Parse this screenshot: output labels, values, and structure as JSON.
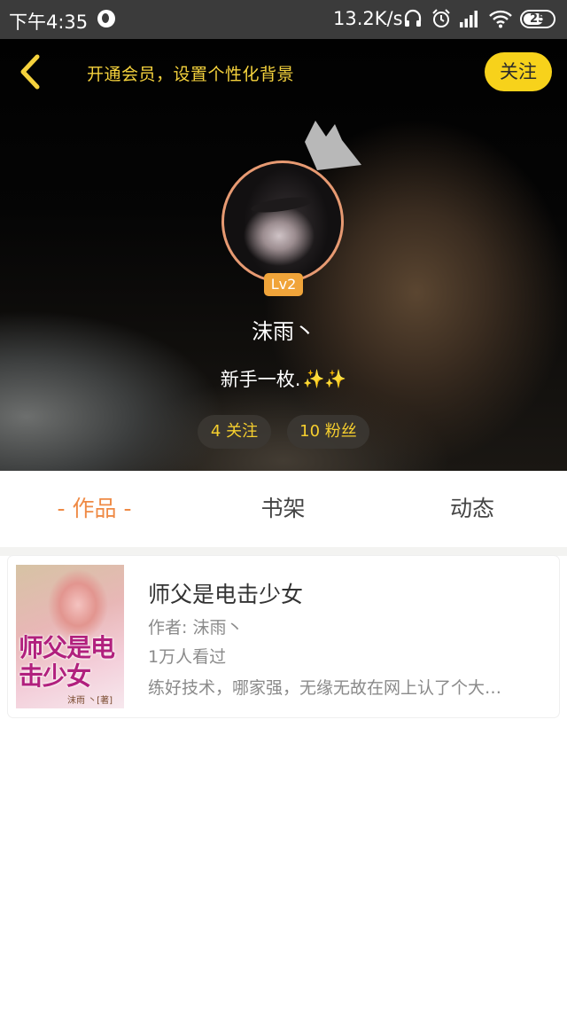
{
  "status_bar": {
    "time": "下午4:35",
    "network_speed": "13.2K/s",
    "battery_level": "25",
    "icons": [
      "globe-icon",
      "headphones-icon",
      "alarm-icon",
      "signal-icon",
      "wifi-icon",
      "battery-icon"
    ]
  },
  "header": {
    "member_banner": "开通会员，设置个性化背景",
    "follow_label": "关注",
    "level": "Lv2",
    "username": "沫雨丶",
    "bio": "新手一枚.",
    "bio_emoji": "✨✨",
    "following": "4 关注",
    "followers": "10 粉丝"
  },
  "tabs": [
    {
      "label": "- 作品 -",
      "active": true
    },
    {
      "label": "书架",
      "active": false
    },
    {
      "label": "动态",
      "active": false
    }
  ],
  "books": [
    {
      "title": "师父是电击少女",
      "author": "作者: 沫雨丶",
      "views": "1万人看过",
      "description": "练好技术，哪家强，无缘无故在网上认了个大…",
      "cover_title": "师父是电击少女",
      "cover_author": "沫雨 丶[著]"
    }
  ],
  "colors": {
    "accent_yellow": "#f7d21b",
    "tab_active": "#ef8a45",
    "level_badge": "#f0a43a",
    "avatar_border": "#e79a72"
  }
}
